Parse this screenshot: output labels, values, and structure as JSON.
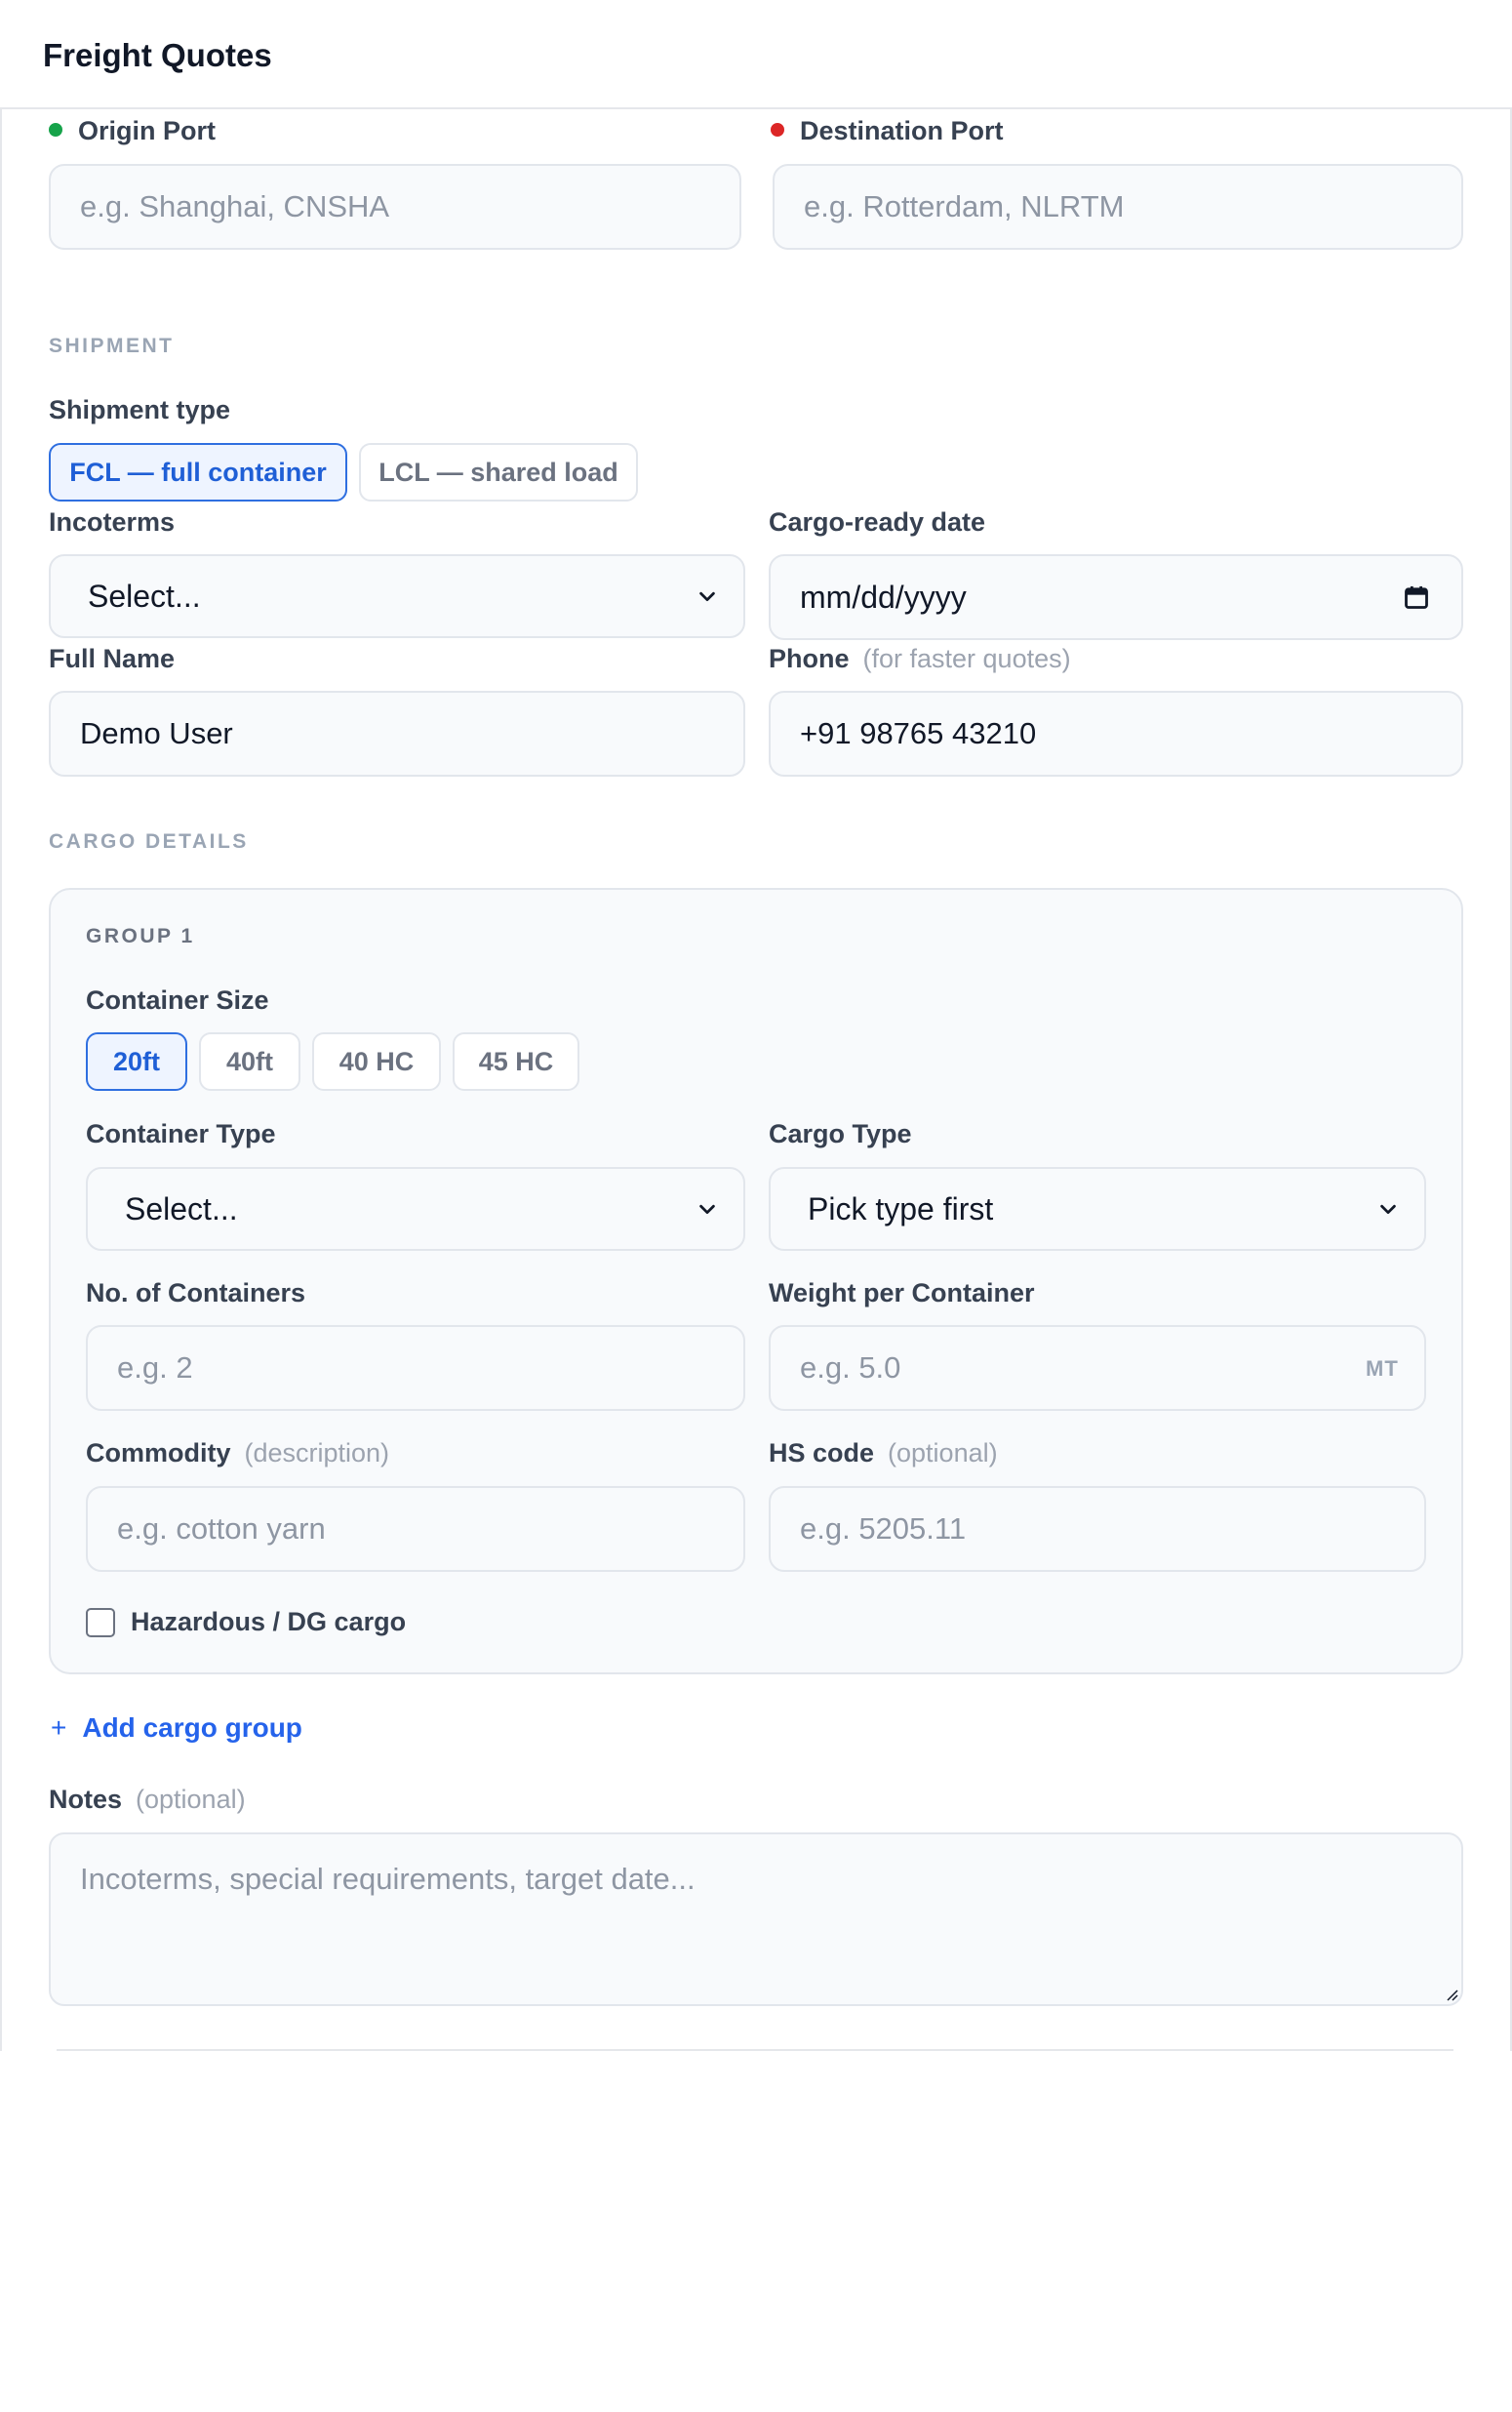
{
  "header": {
    "title": "Freight Quotes"
  },
  "route": {
    "origin_label": "Origin Port",
    "origin_placeholder": "e.g. Shanghai, CNSHA",
    "origin_dot_color": "#16a34a",
    "destination_label": "Destination Port",
    "destination_placeholder": "e.g. Rotterdam, NLRTM",
    "destination_dot_color": "#dc2626"
  },
  "shipment": {
    "section_title": "SHIPMENT",
    "type_label": "Shipment type",
    "type_options": [
      "FCL — full container",
      "LCL — shared load"
    ],
    "type_selected": "FCL — full container",
    "incoterms_label": "Incoterms",
    "incoterms_value": "Select...",
    "cargo_ready_label": "Cargo-ready date",
    "cargo_ready_value": "mm/dd/yyyy",
    "full_name_label": "Full Name",
    "full_name_value": "Demo User",
    "phone_label": "Phone",
    "phone_hint": "(for faster quotes)",
    "phone_value": "+91 98765 43210"
  },
  "cargo": {
    "section_title": "CARGO DETAILS",
    "group_title": "GROUP 1",
    "container_size_label": "Container Size",
    "container_sizes": [
      "20ft",
      "40ft",
      "40 HC",
      "45 HC"
    ],
    "container_size_selected": "20ft",
    "container_type_label": "Container Type",
    "container_type_value": "Select...",
    "cargo_type_label": "Cargo Type",
    "cargo_type_value": "Pick type first",
    "num_containers_label": "No. of Containers",
    "num_containers_placeholder": "e.g. 2",
    "weight_label": "Weight per Container",
    "weight_placeholder": "e.g. 5.0",
    "weight_unit": "MT",
    "commodity_label": "Commodity",
    "commodity_hint": "(description)",
    "commodity_placeholder": "e.g. cotton yarn",
    "hs_code_label": "HS code",
    "hs_code_hint": "(optional)",
    "hs_code_placeholder": "e.g. 5205.11",
    "hazardous_label": "Hazardous / DG cargo",
    "add_group_label": "Add cargo group"
  },
  "notes": {
    "label": "Notes",
    "hint": "(optional)",
    "placeholder": "Incoterms, special requirements, target date..."
  },
  "colors": {
    "accent": "#2563eb",
    "border": "#e2e6ec",
    "field_bg": "#f8fafc"
  },
  "icons": [
    "chevron-down-icon",
    "calendar-icon",
    "plus-icon"
  ]
}
